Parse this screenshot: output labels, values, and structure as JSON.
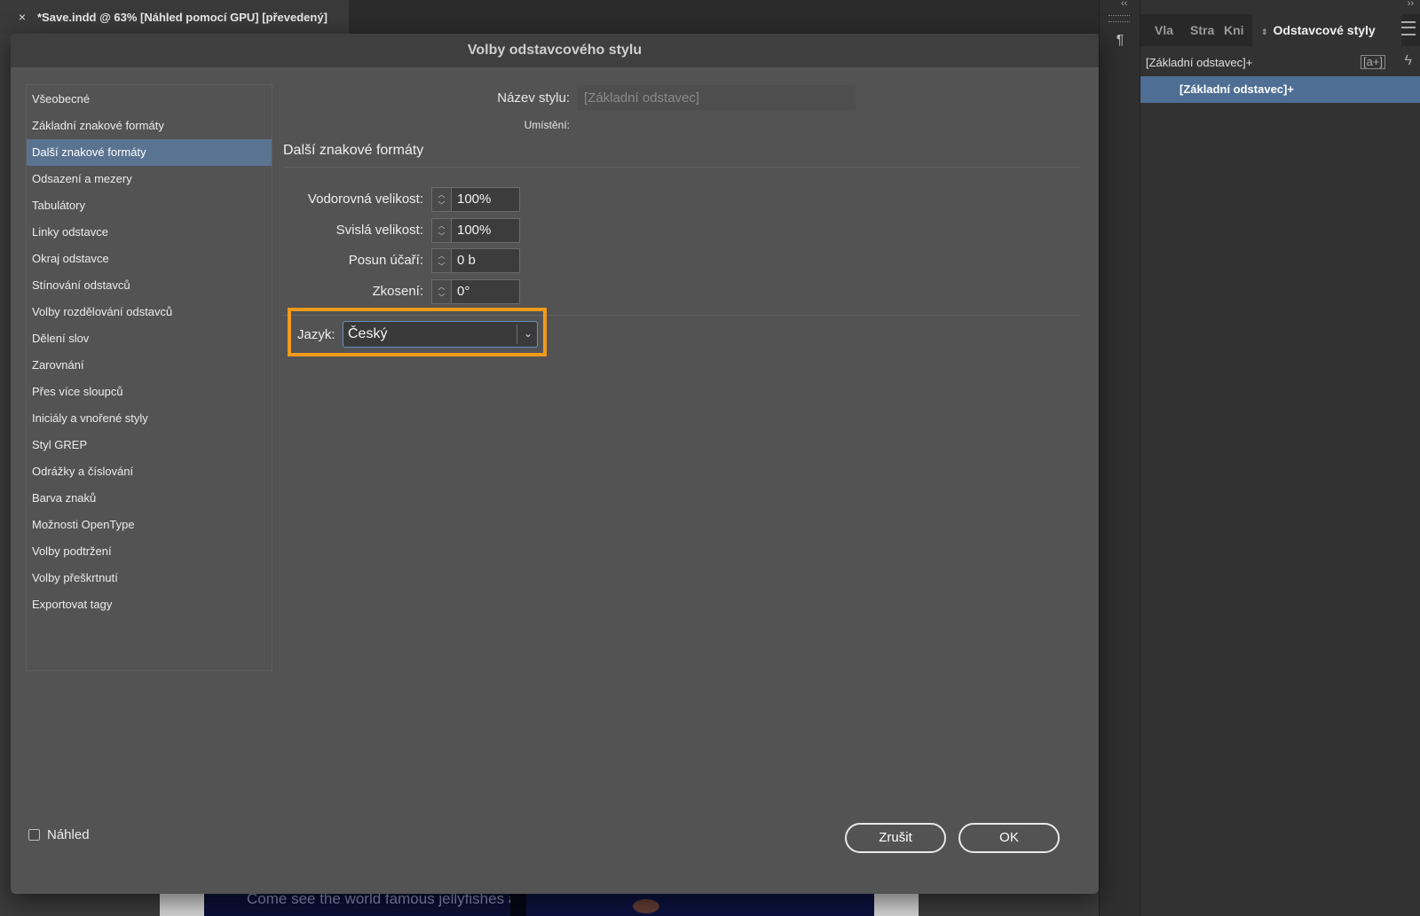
{
  "document_tab": {
    "close_glyph": "×",
    "title": "*Save.indd @ 63% [Náhled pomocí GPU] [převedený]"
  },
  "canvas": {
    "image_text": "Come see the world famous jellyfishes at our weekly Nightwalk Guide along"
  },
  "panel": {
    "tabs": [
      "Vla",
      "Stra",
      "Kni",
      "Odstavcové styly"
    ],
    "current_style": "[Základní odstavec]+",
    "new_style_glyph": "[a+]",
    "style_items": [
      "[Základní odstavec]+"
    ]
  },
  "dialog": {
    "title": "Volby odstavcového stylu",
    "categories": [
      "Všeobecné",
      "Základní znakové formáty",
      "Další znakové formáty",
      "Odsazení a mezery",
      "Tabulátory",
      "Linky odstavce",
      "Okraj odstavce",
      "Stínování odstavců",
      "Volby rozdělování odstavců",
      "Dělení slov",
      "Zarovnání",
      "Přes více sloupců",
      "Iniciály a vnořené styly",
      "Styl GREP",
      "Odrážky a číslování",
      "Barva znaků",
      "Možnosti OpenType",
      "Volby podtržení",
      "Volby přeškrtnutí",
      "Exportovat tagy"
    ],
    "selected_category": "Další znakové formáty",
    "style_name_label": "Název stylu:",
    "style_name_value": "[Základní odstavec]",
    "location_label": "Umístění:",
    "section_title": "Další znakové formáty",
    "fields": {
      "horizontal_scale": {
        "label": "Vodorovná velikost:",
        "value": "100%"
      },
      "vertical_scale": {
        "label": "Svislá velikost:",
        "value": "100%"
      },
      "baseline_shift": {
        "label": "Posun účaří:",
        "value": "0 b"
      },
      "skew": {
        "label": "Zkosení:",
        "value": "0°"
      }
    },
    "language": {
      "label": "Jazyk:",
      "value": "Český"
    },
    "preview_label": "Náhled",
    "cancel_label": "Zrušit",
    "ok_label": "OK"
  },
  "colors": {
    "highlight_box": "#f29a1b",
    "selected_category": "#5a7391",
    "panel_selected": "#4e6e94"
  }
}
